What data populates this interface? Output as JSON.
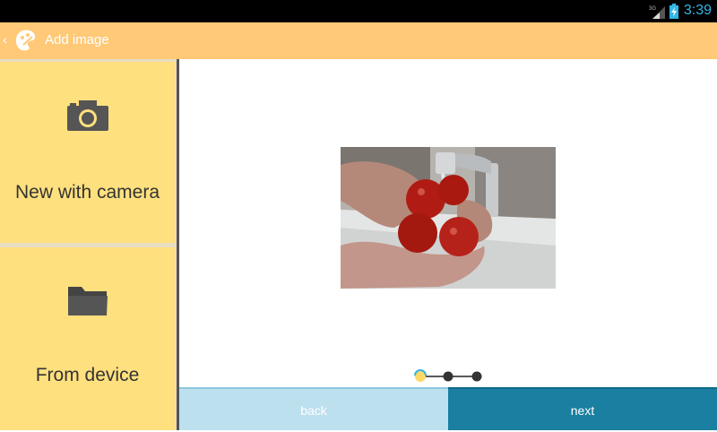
{
  "status_bar": {
    "network": "3G",
    "time": "3:39"
  },
  "action_bar": {
    "up_glyph": "‹",
    "title": "Add image",
    "logo_icon": "palette-logo-icon"
  },
  "sources": {
    "camera": {
      "label": "New with camera",
      "icon": "camera-icon"
    },
    "device": {
      "label": "From device",
      "icon": "folder-icon"
    }
  },
  "preview": {
    "description_icon": "photo-preview"
  },
  "pager": {
    "total_steps": 3,
    "current_step": 1
  },
  "buttons": {
    "back": "back",
    "next": "next"
  },
  "colors": {
    "action_bar": "#ffc977",
    "tile": "#ffe07e",
    "back_button": "#bde0ee",
    "next_button": "#1a7fa0",
    "status_time": "#33b5e5"
  }
}
